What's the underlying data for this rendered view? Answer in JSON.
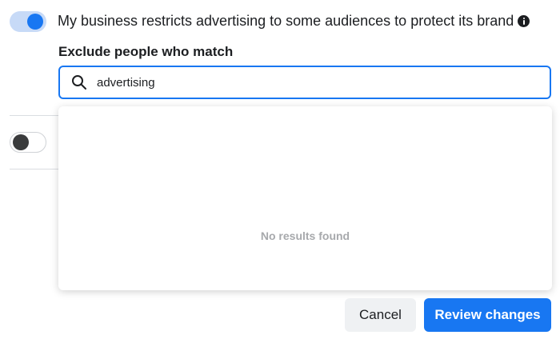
{
  "settings": {
    "restrict_toggle": {
      "on": true
    },
    "restrict_label": "My business restricts advertising to some audiences to protect its brand",
    "info_icon": "info-icon",
    "second_toggle": {
      "on": false
    }
  },
  "exclude": {
    "title": "Exclude people who match",
    "search": {
      "value": "advertising",
      "icon": "search-icon"
    },
    "dropdown": {
      "empty_text": "No results found"
    }
  },
  "footer": {
    "cancel_label": "Cancel",
    "review_label": "Review changes"
  },
  "colors": {
    "accent": "#1877f2",
    "toggle_track_on": "#c7daf7",
    "muted_text": "#a7a9ac"
  }
}
